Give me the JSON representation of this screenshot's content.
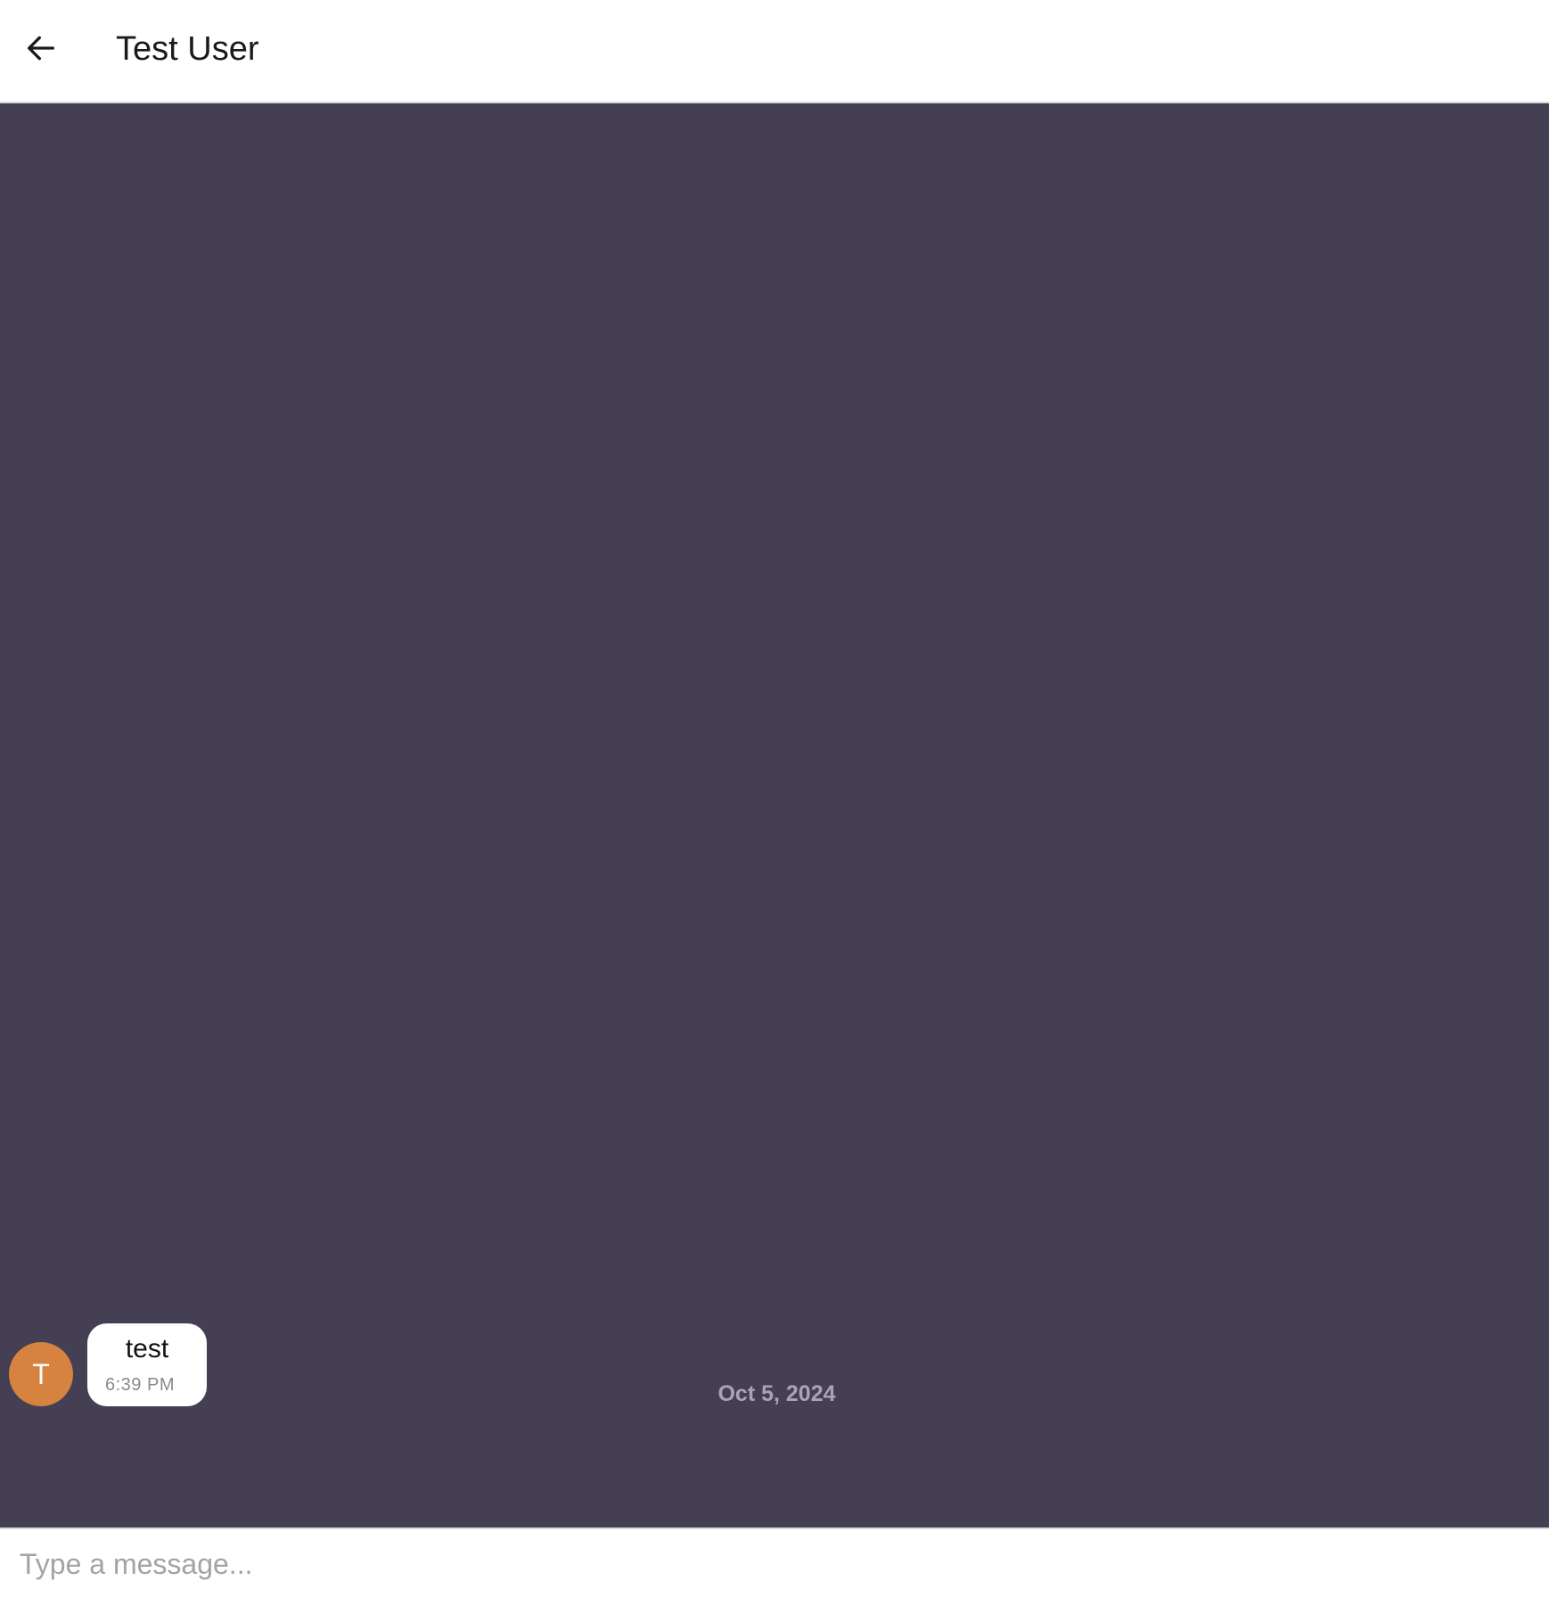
{
  "header": {
    "back_icon": "arrow-left-icon",
    "title": "Test User"
  },
  "chat": {
    "background_color": "#453f54",
    "date_separator": "Oct 5, 2024",
    "messages": [
      {
        "avatar_initial": "T",
        "avatar_color": "#d5833e",
        "text": "test",
        "time": "6:39 PM"
      }
    ]
  },
  "composer": {
    "placeholder": "Type a message..."
  }
}
